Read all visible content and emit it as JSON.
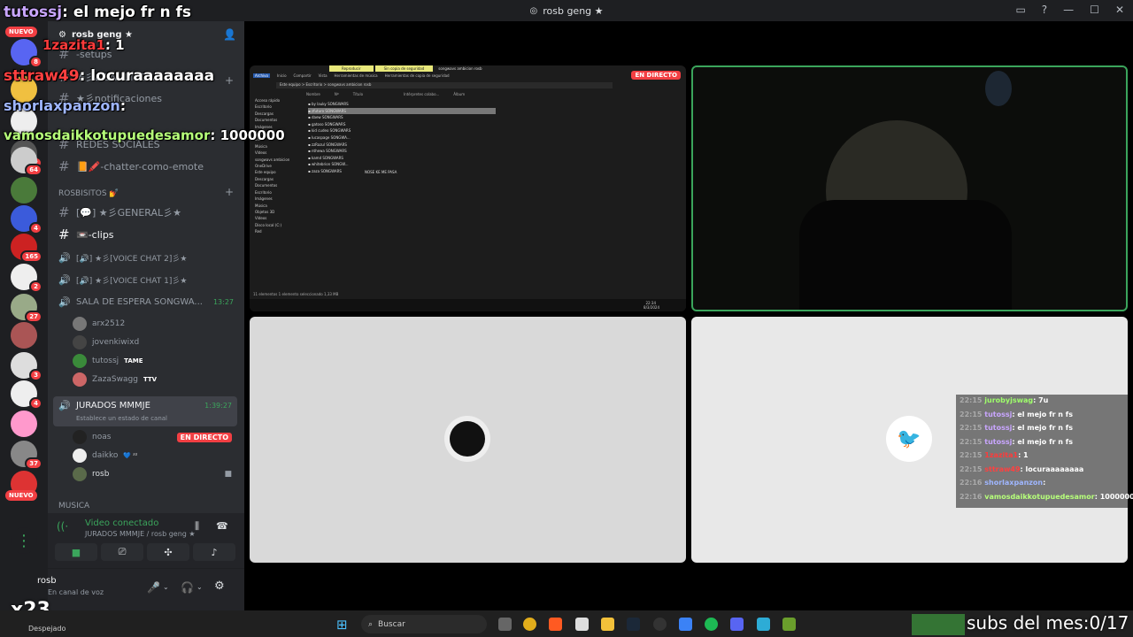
{
  "window": {
    "title": "rosb geng ★"
  },
  "server": {
    "name": "rosb geng ★",
    "channels_top": [
      "-setups",
      "★彡BIENVENIDA彡★",
      "★彡notificaciones",
      "REDES SOCIALES",
      "📙🖍️-chatter-como-emote"
    ],
    "category_1": "ROSBISITOS 💅",
    "channels_mid": [
      "[💬] ★彡GENERAL彡★",
      "📼-clips",
      "[🔊] ★彡[VOICE CHAT 2]彡★",
      "[🔊] ★彡[VOICE CHAT 1]彡★"
    ],
    "waiting_room": {
      "name": "SALA DE ESPERA SONGWA...",
      "time": "13:27"
    },
    "waiting_users": [
      {
        "name": "arx2512",
        "tag": ""
      },
      {
        "name": "jovenkiwixd",
        "tag": ""
      },
      {
        "name": "tutossj",
        "tag": "TAME"
      },
      {
        "name": "ZazaSwagg",
        "tag": "TTV"
      }
    ],
    "jurados": {
      "name": "JURADOS MMMJE",
      "time": "1:39:27",
      "status": "Establece un estado de canal"
    },
    "jurados_users": [
      {
        "name": "noas",
        "live": "EN DIRECTO"
      },
      {
        "name": "daikko",
        "tag": "💙 ᶻᶻ"
      },
      {
        "name": "rosb"
      }
    ],
    "category_2": "MUSICA"
  },
  "voice_panel": {
    "status": "Video conectado",
    "location": "JURADOS MMMJE / rosb geng ★"
  },
  "user_panel": {
    "name": "rosb",
    "status": "En canal de voz"
  },
  "rail": {
    "badges": [
      "8",
      "2",
      "64",
      "4",
      "165",
      "2",
      "27",
      "3",
      "4",
      "37"
    ],
    "new_label": "NUEVO"
  },
  "screenshare": {
    "live_label": "EN DIRECTO",
    "ribbon": [
      "Reproducir",
      "Sin copia de seguridad",
      "songwavs ambicion rosb"
    ],
    "tabs": [
      "Archivo",
      "Inicio",
      "Compartir",
      "Vista",
      "Herramientas de música",
      "Herramientas de copia de seguridad"
    ],
    "path": "Este equipo > Escritorio > songwavs ambicion rosb",
    "columns": [
      "Nombre",
      "Nº",
      "Título",
      "Intérpretes colabo...",
      "Álbum"
    ],
    "files": [
      "by lauky SONGWARS",
      "zfuturo SONGWARS",
      "daew SONGWARS",
      "gatoso SONGWARS",
      "kid cudeo SONGWARS",
      "lucaspage SONGWA...",
      "zzRazul SONGWARS",
      "nthewa SONGWARS",
      "kamd SONGWARS",
      "whitebrion SONGW...",
      "zaza SONGWARS"
    ],
    "file_note": "NOSE KE ME PASA",
    "nav": [
      "Acceso rápido",
      "Escritorio",
      "Descargas",
      "Documentos",
      "Imágenes",
      "Audio",
      "Live",
      "Música",
      "Vídeos",
      "songwavs ambicion",
      "OneDrive",
      "Este equipo",
      "Descargas",
      "Documentos",
      "Escritorio",
      "Imágenes",
      "Música",
      "Objetos 3D",
      "Vídeos",
      "Disco local (C:)",
      "Red"
    ],
    "statusbar": "11 elementos   1 elemento seleccionado  1,33 MB",
    "clock": [
      "22:34",
      "8/3/2024"
    ]
  },
  "overlay_chat_left": [
    {
      "user": "tutossj",
      "msg": ": el mejo fr n fs",
      "color": "#c9a6ff"
    },
    {
      "user": "1zazita1",
      "msg": ": 1",
      "color": "#ff3b3b"
    },
    {
      "user": "sttraw49",
      "msg": ": locuraaaaaaaa",
      "color": "#ff4040"
    },
    {
      "user": "shorlaxpanzon",
      "msg": ":",
      "color": "#9fb6ff"
    },
    {
      "user": "vamosdaikkotupuedesamor",
      "msg": ": 1000000",
      "color": "#b6ff7a"
    }
  ],
  "overlay_chat_right": [
    {
      "time": "22:15",
      "user": "jurobyjswag",
      "msg": ": 7u",
      "color": "#9fff6b"
    },
    {
      "time": "22:15",
      "user": "tutossj",
      "msg": ": el mejo fr n fs",
      "color": "#c9a6ff"
    },
    {
      "time": "22:15",
      "user": "tutossj",
      "msg": ": el mejo fr n fs",
      "color": "#c9a6ff"
    },
    {
      "time": "22:15",
      "user": "tutossj",
      "msg": ": el mejo fr n fs",
      "color": "#c9a6ff"
    },
    {
      "time": "22:15",
      "user": "1zazita1",
      "msg": ": 1",
      "color": "#ff3b3b"
    },
    {
      "time": "22:15",
      "user": "sttraw49",
      "msg": ": locuraaaaaaaa",
      "color": "#ff4040"
    },
    {
      "time": "22:16",
      "user": "shorlaxpanzon",
      "msg": ":",
      "color": "#9fb6ff"
    },
    {
      "time": "22:16",
      "user": "vamosdaikkotupuedesamor",
      "msg": ": 1000000",
      "color": "#b6ff7a"
    }
  ],
  "subs": {
    "label": "subs del mes:",
    "value": "0/17"
  },
  "multiplier": "x23",
  "weather": "Despejado",
  "taskbar": {
    "search": "Buscar"
  }
}
